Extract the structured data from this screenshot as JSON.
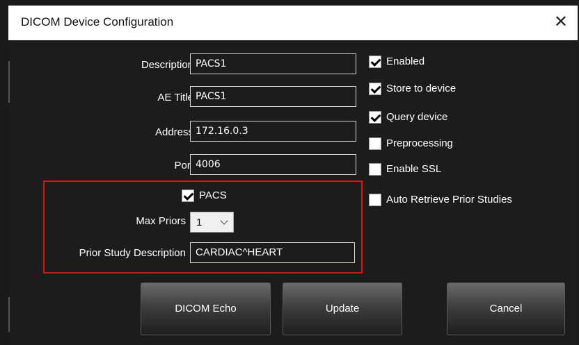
{
  "window": {
    "title": "DICOM Device Configuration",
    "close_glyph": "✕"
  },
  "fields": {
    "description": {
      "label": "Description",
      "value": "PACS1"
    },
    "ae_title": {
      "label": "AE Title",
      "value": "PACS1"
    },
    "address": {
      "label": "Address",
      "value": "172.16.0.3"
    },
    "port": {
      "label": "Port",
      "value": "4006"
    }
  },
  "options": [
    {
      "label": "Enabled",
      "checked": true
    },
    {
      "label": "Store to device",
      "checked": true
    },
    {
      "label": "Query device",
      "checked": true
    },
    {
      "label": "Preprocessing",
      "checked": false
    },
    {
      "label": "Enable SSL",
      "checked": false
    },
    {
      "label": "Auto Retrieve Prior Studies",
      "checked": false
    }
  ],
  "pacs": {
    "label": "PACS",
    "checked": true,
    "max_priors_label": "Max Priors",
    "max_priors_value": "1",
    "prior_desc_label": "Prior Study Description",
    "prior_desc_value": "CARDIAC^HEART"
  },
  "buttons": {
    "echo": "DICOM Echo",
    "update": "Update",
    "cancel": "Cancel"
  },
  "colors": {
    "highlight": "#d61414",
    "background": "#1c1c1c",
    "titlebar": "#ffffff"
  }
}
